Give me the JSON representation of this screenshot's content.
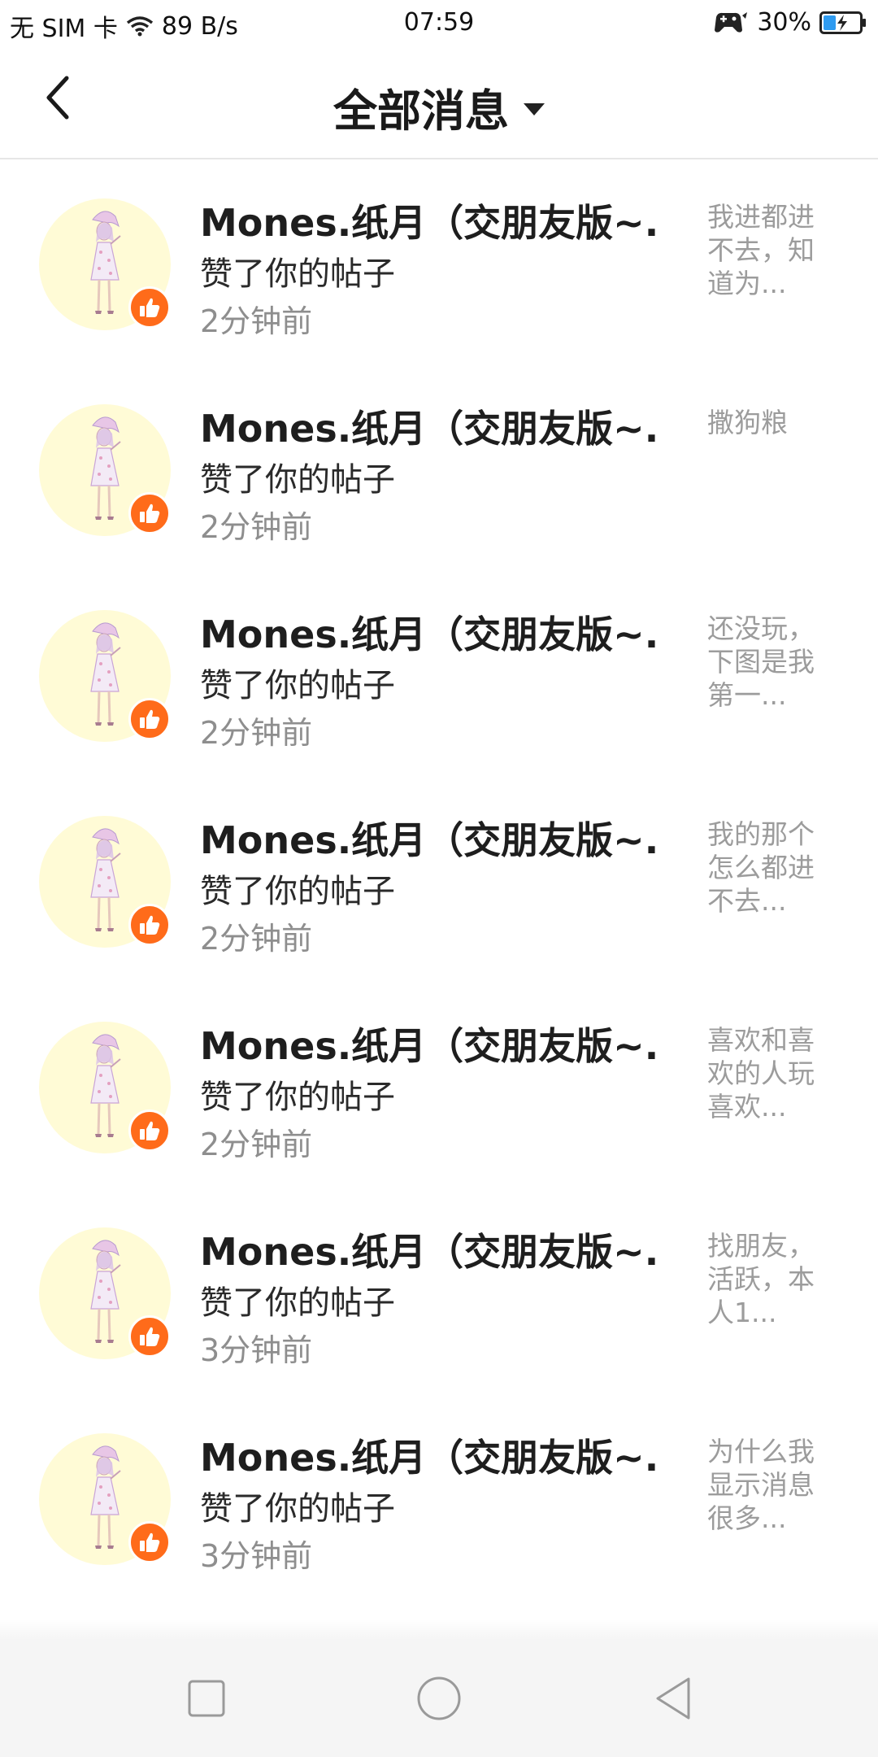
{
  "status_bar": {
    "carrier": "无 SIM 卡",
    "speed": "89 B/s",
    "time": "07:59",
    "battery": "30%"
  },
  "header": {
    "title": "全部消息"
  },
  "messages": [
    {
      "name": "Mones.纸月（交朋友版~...",
      "action": "赞了你的帖子",
      "time": "2分钟前",
      "preview": "我进都进不去，知道为..."
    },
    {
      "name": "Mones.纸月（交朋友版~...",
      "action": "赞了你的帖子",
      "time": "2分钟前",
      "preview": "撒狗粮"
    },
    {
      "name": "Mones.纸月（交朋友版~...",
      "action": "赞了你的帖子",
      "time": "2分钟前",
      "preview": "还没玩，下图是我第一..."
    },
    {
      "name": "Mones.纸月（交朋友版~...",
      "action": "赞了你的帖子",
      "time": "2分钟前",
      "preview": "我的那个怎么都进不去..."
    },
    {
      "name": "Mones.纸月（交朋友版~...",
      "action": "赞了你的帖子",
      "time": "2分钟前",
      "preview": "喜欢和喜欢的人玩喜欢..."
    },
    {
      "name": "Mones.纸月（交朋友版~...",
      "action": "赞了你的帖子",
      "time": "3分钟前",
      "preview": "找朋友，活跃，本人1..."
    },
    {
      "name": "Mones.纸月（交朋友版~...",
      "action": "赞了你的帖子",
      "time": "3分钟前",
      "preview": "为什么我显示消息很多..."
    }
  ],
  "icons": {
    "back": "back-arrow-icon",
    "dropdown": "dropdown-triangle-icon",
    "like": "thumbs-up-icon",
    "nav_recent": "square-icon",
    "nav_home": "circle-icon",
    "nav_back": "triangle-back-icon"
  },
  "colors": {
    "like_badge": "#ff6b1a",
    "avatar_bg": "#fffbd6"
  }
}
